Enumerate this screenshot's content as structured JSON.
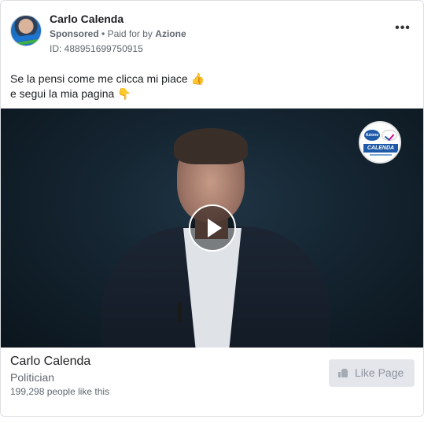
{
  "ad": {
    "page_name": "Carlo Calenda",
    "sponsored": "Sponsored",
    "separator": "•",
    "paid_for_prefix": "Paid for by",
    "payer": "Azione",
    "id_label": "ID: 488951699750915",
    "more_glyph": "•••",
    "body_line1": "Se la pensi come me clicca mi piace 👍",
    "body_line2": "e segui la mia pagina 👇"
  },
  "video": {
    "logo_top_left": "Azione",
    "logo_name": "CALENDA",
    "logo_colors": {
      "blue": "#1f5aa8",
      "magenta": "#e5007d"
    },
    "play_icon": "play-icon"
  },
  "footer": {
    "title": "Carlo Calenda",
    "category": "Politician",
    "likes": "199,298 people like this",
    "like_button": "Like Page"
  },
  "colors": {
    "secondary_text": "#606770",
    "button_bg": "#e4e6eb",
    "button_text": "#8d949e"
  }
}
